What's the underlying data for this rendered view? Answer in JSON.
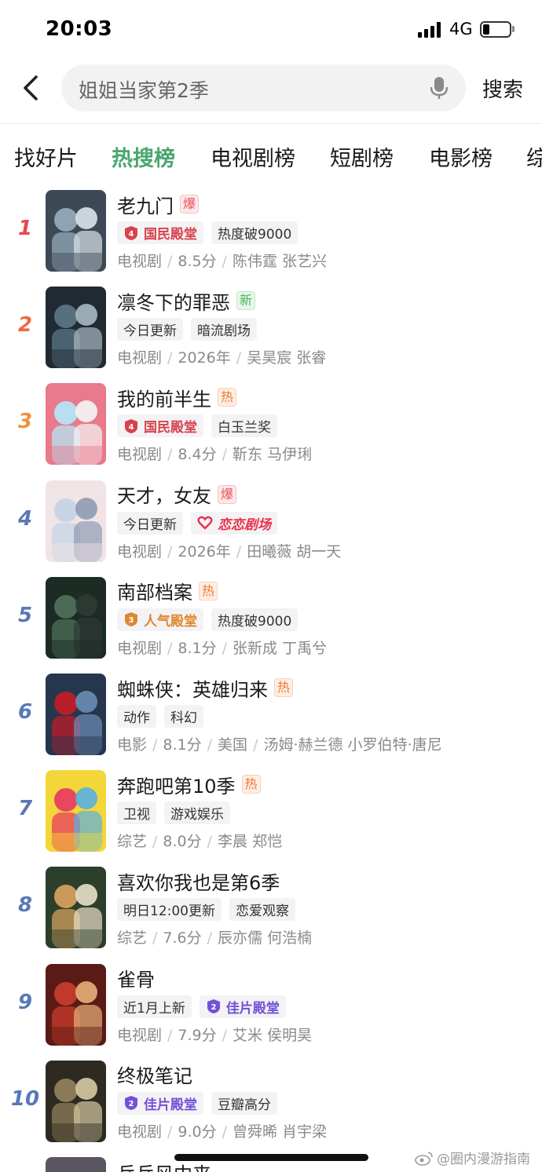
{
  "status_bar": {
    "time": "20:03",
    "network": "4G",
    "battery_level": 0.25
  },
  "search": {
    "query": "姐姐当家第2季",
    "search_label": "搜索"
  },
  "tabs": [
    {
      "label": "找好片",
      "active": false
    },
    {
      "label": "热搜榜",
      "active": true
    },
    {
      "label": "电视剧榜",
      "active": false
    },
    {
      "label": "短剧榜",
      "active": false
    },
    {
      "label": "电影榜",
      "active": false
    },
    {
      "label": "综",
      "active": false
    }
  ],
  "colors": {
    "accent_green": "#4aa66c",
    "rank_top1": "#e8474f",
    "rank_top2": "#ef6a3a",
    "rank_top3": "#f0913b",
    "rank_other": "#5878b8"
  },
  "list": [
    {
      "rank": "1",
      "title": "老九门",
      "badge": "爆",
      "badge_type": "bao",
      "tags": [
        {
          "type": "hall-red",
          "icon": "hall-4-icon",
          "text": "国民殿堂"
        },
        {
          "type": "plain",
          "text": "热度破9000"
        }
      ],
      "meta": [
        "电视剧",
        "8.5分",
        "陈伟霆 张艺兴"
      ]
    },
    {
      "rank": "2",
      "title": "凛冬下的罪恶",
      "badge": "新",
      "badge_type": "xin",
      "tags": [
        {
          "type": "plain",
          "text": "今日更新"
        },
        {
          "type": "plain",
          "text": "暗流剧场"
        }
      ],
      "meta": [
        "电视剧",
        "2026年",
        "吴昊宸 张睿"
      ]
    },
    {
      "rank": "3",
      "title": "我的前半生",
      "badge": "热",
      "badge_type": "re",
      "tags": [
        {
          "type": "hall-red",
          "icon": "hall-4-icon",
          "text": "国民殿堂"
        },
        {
          "type": "plain",
          "text": "白玉兰奖"
        }
      ],
      "meta": [
        "电视剧",
        "8.4分",
        "靳东 马伊琍"
      ]
    },
    {
      "rank": "4",
      "title": "天才，女友",
      "badge": "爆",
      "badge_type": "bao",
      "tags": [
        {
          "type": "plain",
          "text": "今日更新"
        },
        {
          "type": "romance",
          "icon": "romance-theater-icon",
          "text": "恋恋剧场"
        }
      ],
      "meta": [
        "电视剧",
        "2026年",
        "田曦薇 胡一天"
      ]
    },
    {
      "rank": "5",
      "title": "南部档案",
      "badge": "热",
      "badge_type": "re",
      "tags": [
        {
          "type": "hall-orange",
          "icon": "hall-3-icon",
          "text": "人气殿堂"
        },
        {
          "type": "plain",
          "text": "热度破9000"
        }
      ],
      "meta": [
        "电视剧",
        "8.1分",
        "张新成 丁禹兮"
      ]
    },
    {
      "rank": "6",
      "title": "蜘蛛侠：英雄归来",
      "badge": "热",
      "badge_type": "re",
      "tags": [
        {
          "type": "plain",
          "text": "动作"
        },
        {
          "type": "plain",
          "text": "科幻"
        }
      ],
      "meta": [
        "电影",
        "8.1分",
        "美国",
        "汤姆·赫兰德 小罗伯特·唐尼"
      ]
    },
    {
      "rank": "7",
      "title": "奔跑吧第10季",
      "badge": "热",
      "badge_type": "re",
      "tags": [
        {
          "type": "plain",
          "text": "卫视"
        },
        {
          "type": "plain",
          "text": "游戏娱乐"
        }
      ],
      "meta": [
        "综艺",
        "8.0分",
        "李晨 郑恺"
      ]
    },
    {
      "rank": "8",
      "title": "喜欢你我也是第6季",
      "badge": "",
      "badge_type": "",
      "tags": [
        {
          "type": "plain",
          "text": "明日12:00更新"
        },
        {
          "type": "plain",
          "text": "恋爱观察"
        }
      ],
      "meta": [
        "综艺",
        "7.6分",
        "辰亦儒 何浩楠"
      ]
    },
    {
      "rank": "9",
      "title": "雀骨",
      "badge": "",
      "badge_type": "",
      "tags": [
        {
          "type": "plain",
          "text": "近1月上新"
        },
        {
          "type": "hall-purple",
          "icon": "hall-2-icon",
          "text": "佳片殿堂"
        }
      ],
      "meta": [
        "电视剧",
        "7.9分",
        "艾米 侯明昊"
      ]
    },
    {
      "rank": "10",
      "title": "终极笔记",
      "badge": "",
      "badge_type": "",
      "tags": [
        {
          "type": "hall-purple",
          "icon": "hall-2-icon",
          "text": "佳片殿堂"
        },
        {
          "type": "plain",
          "text": "豆瓣高分"
        }
      ],
      "meta": [
        "电视剧",
        "9.0分",
        "曾舜晞 肖宇梁"
      ]
    }
  ],
  "partial_item": {
    "title": "乒乓风中来"
  },
  "watermark": "@圈内漫游指南"
}
